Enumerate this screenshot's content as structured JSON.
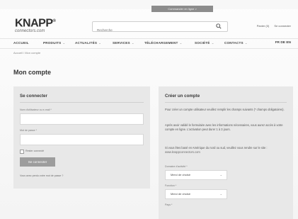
{
  "promo": {
    "text": "Commander en ligne >"
  },
  "header": {
    "logo_main": "KNAPP",
    "logo_sub": "connectors.com",
    "search_placeholder": "Recherche",
    "top_links": [
      "Panier (0)",
      "Se connecter"
    ]
  },
  "nav": {
    "items": [
      "ACCUEIL",
      "PRODUITS",
      "ACTUALITÉS",
      "SERVICES",
      "TÉLÉCHARGEMENT",
      "SOCIÉTÉ",
      "CONTACTS"
    ],
    "flags": "FR DE EN"
  },
  "breadcrumb": "Accueil / Mon compte",
  "page_title": "Mon compte",
  "login": {
    "title": "Se connecter",
    "username_label": "Nom d'utilisateur ou e-mail *",
    "password_label": "Mot de passe *",
    "remember_label": "Rester connecté",
    "button_label": "Se connecter",
    "lost_password": "Vous avez perdu votre mot de passe ?"
  },
  "register": {
    "title": "Créer un compte",
    "intro": "Pour créer un compte utilisateur veuillez remplir les champs suivants (* champs obligatoires).",
    "validation": "Après avoir validé le formulaire avec les informations nécessaires, vous aurez accès à votre compte en ligne. L'activation peut durer 1 à 3 jours.",
    "support_text": "Si vous êtes basé en Amérique du nord ou sud, veuillez vous rendre sur le site :",
    "support_link": "www.knappconnectors.com",
    "select1_label": "Domaine d'activité *",
    "select2_label": "Fonction *",
    "select3_label": "Pays *",
    "select_value": "Merci de choisir"
  }
}
